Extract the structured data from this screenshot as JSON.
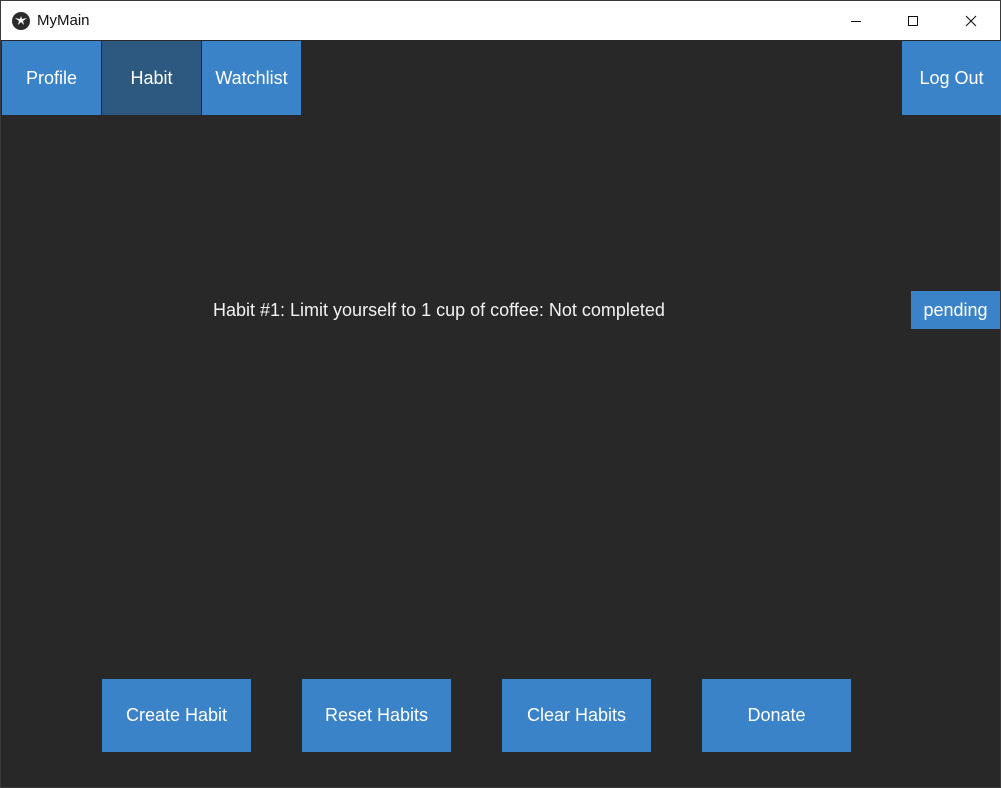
{
  "window": {
    "title": "MyMain",
    "app_icon": "kivy-logo-icon",
    "controls": {
      "minimize_icon": "minimize-icon",
      "maximize_icon": "maximize-icon",
      "close_icon": "close-icon"
    }
  },
  "nav": {
    "items": [
      {
        "label": "Profile",
        "active": false
      },
      {
        "label": "Habit",
        "active": true
      },
      {
        "label": "Watchlist",
        "active": false
      }
    ],
    "logout_label": "Log Out"
  },
  "habits": [
    {
      "text": "Habit #1: Limit yourself to 1 cup of coffee: Not completed",
      "status_button": "pending"
    }
  ],
  "actions": {
    "create_label": "Create Habit",
    "reset_label": "Reset Habits",
    "clear_label": "Clear Habits",
    "donate_label": "Donate"
  },
  "colors": {
    "background": "#282828",
    "button": "#3b83c8",
    "button_active": "#2d5880",
    "text": "#ffffff"
  }
}
